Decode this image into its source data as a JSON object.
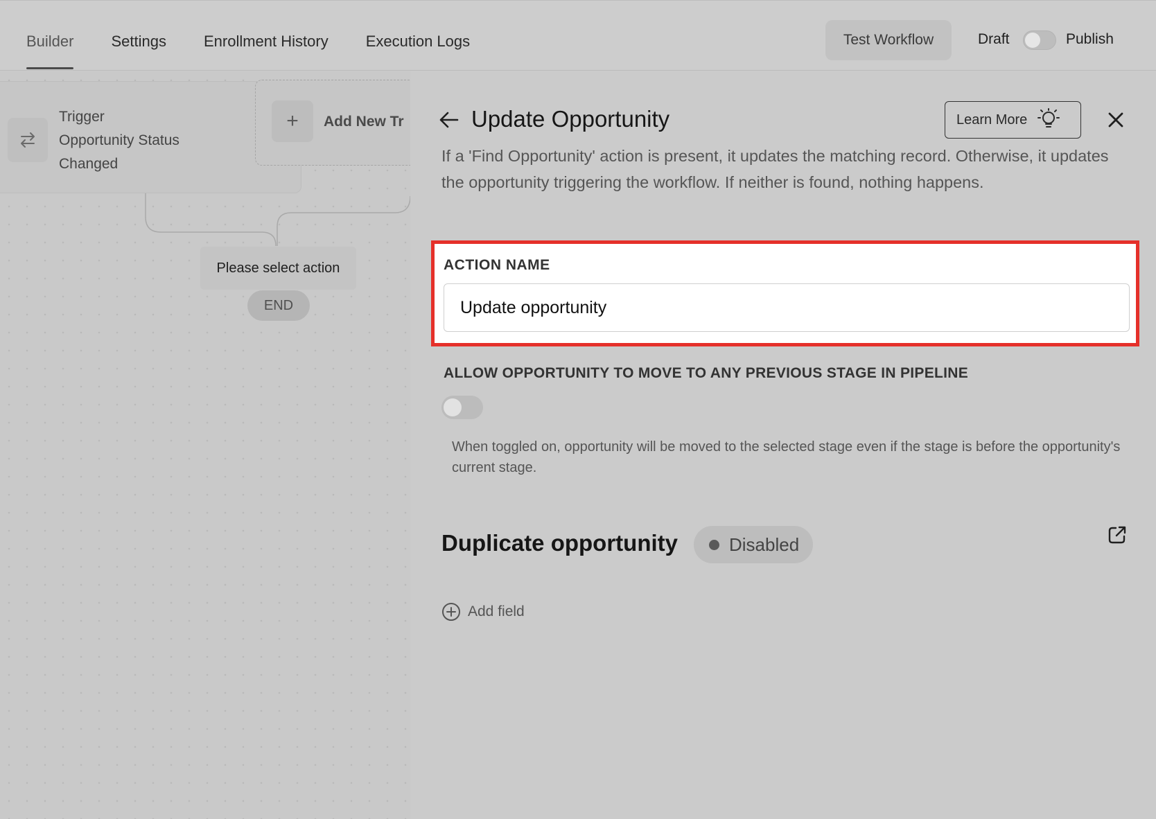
{
  "tabs": [
    {
      "label": "Builder",
      "active": true
    },
    {
      "label": "Settings",
      "active": false
    },
    {
      "label": "Enrollment History",
      "active": false
    },
    {
      "label": "Execution Logs",
      "active": false
    }
  ],
  "header": {
    "test_workflow_label": "Test Workflow",
    "draft_label": "Draft",
    "publish_label": "Publish",
    "publish_toggle_on": false
  },
  "canvas": {
    "trigger": {
      "label": "Trigger",
      "name_line1": "Opportunity Status",
      "name_line2": "Changed"
    },
    "add_trigger_label": "Add New Tr",
    "select_action_label": "Please select action",
    "end_label": "END"
  },
  "panel": {
    "title": "Update Opportunity",
    "learn_more_label": "Learn More",
    "description": "If a 'Find Opportunity' action is present, it updates the matching record. Otherwise, it updates the opportunity triggering the workflow. If neither is found, nothing happens.",
    "action_name": {
      "label": "ACTION NAME",
      "value": "Update opportunity"
    },
    "allow_previous_stage": {
      "label": "ALLOW OPPORTUNITY TO MOVE TO ANY PREVIOUS STAGE IN PIPELINE",
      "enabled": false,
      "help": "When toggled on, opportunity will be moved to the selected stage even if the stage is before the opportunity's current stage."
    },
    "duplicate": {
      "title": "Duplicate opportunity",
      "status": "Disabled"
    },
    "add_field_label": "Add field"
  },
  "colors": {
    "highlight_border": "#e5302a",
    "overlay_gray": "#cbcbcb"
  }
}
